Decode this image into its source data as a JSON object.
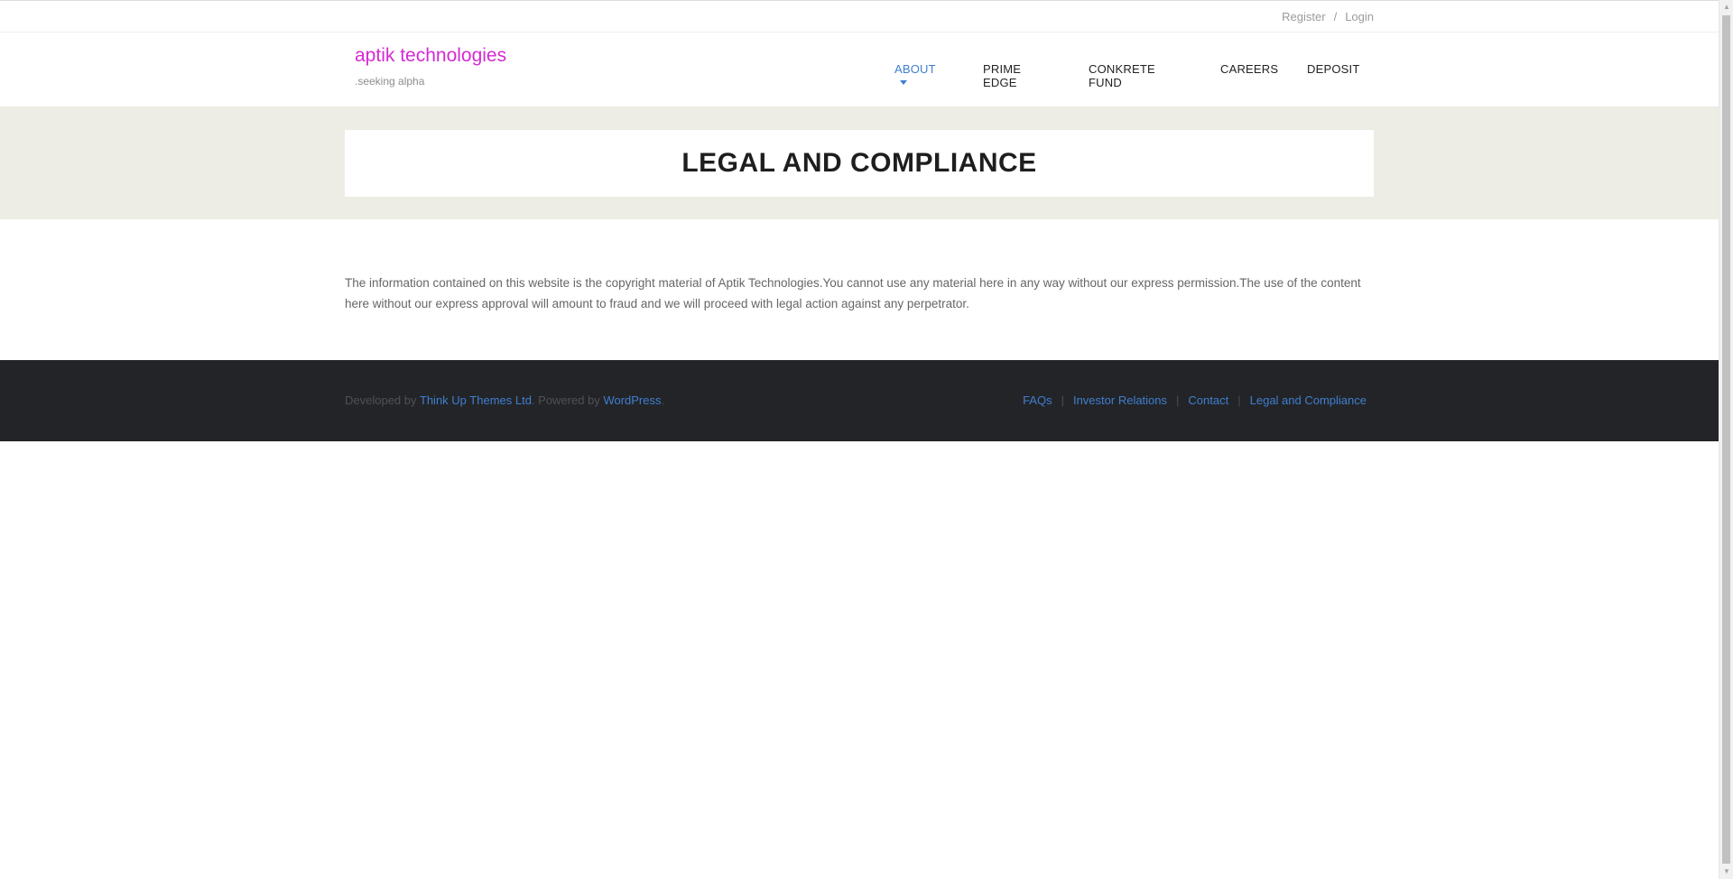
{
  "topbar": {
    "register": "Register",
    "separator": "/",
    "login": "Login"
  },
  "header": {
    "logo_title": "aptik technologies",
    "logo_tagline": ".seeking alpha",
    "nav": [
      {
        "label": "ABOUT",
        "active": true
      },
      {
        "label": "PRIME EDGE"
      },
      {
        "label": "CONKRETE FUND"
      },
      {
        "label": "CAREERS"
      },
      {
        "label": "DEPOSIT"
      }
    ]
  },
  "intro": {
    "title": "LEGAL AND COMPLIANCE"
  },
  "content": {
    "body": "The information contained on this website is the copyright material of Aptik Technologies.You cannot use any material here in any way without our express permission.The use of the content here without our express approval will amount to fraud and we will proceed with legal action against any perpetrator."
  },
  "footer": {
    "developed_by": "Developed by",
    "developer_link": "Think Up Themes Ltd",
    "powered_by": ". Powered by",
    "wordpress_link": "WordPress",
    "period": ".",
    "links": [
      "FAQs",
      "Investor Relations",
      "Contact",
      "Legal and Compliance"
    ],
    "link_separator": "|"
  },
  "colors": {
    "logo": "#d42ad4",
    "accent": "#3f7fd1",
    "intro_bg": "#edece5",
    "footer_bg": "#232427"
  }
}
